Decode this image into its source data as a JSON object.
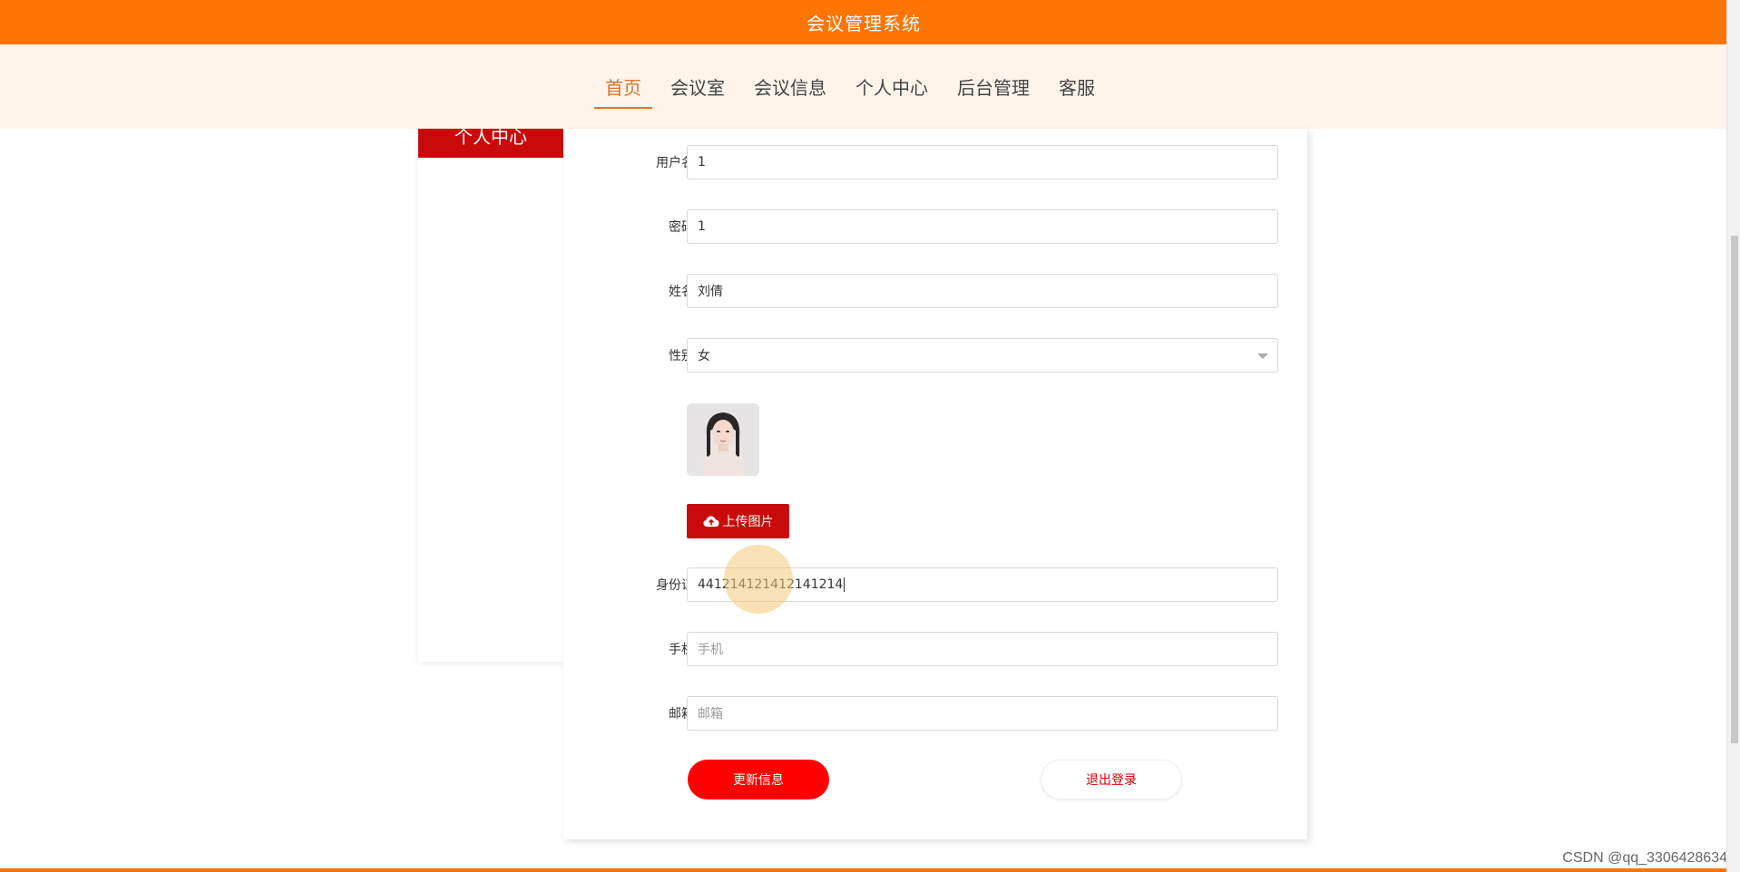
{
  "header": {
    "title": "会议管理系统"
  },
  "nav": {
    "items": [
      {
        "label": "首页",
        "active": true
      },
      {
        "label": "会议室",
        "active": false
      },
      {
        "label": "会议信息",
        "active": false
      },
      {
        "label": "个人中心",
        "active": false
      },
      {
        "label": "后台管理",
        "active": false
      },
      {
        "label": "客服",
        "active": false
      }
    ]
  },
  "sidebar": {
    "title": "个人中心"
  },
  "form": {
    "username": {
      "label": "用户名",
      "value": "1"
    },
    "password": {
      "label": "密码",
      "value": "1"
    },
    "name": {
      "label": "姓名",
      "value": "刘倩"
    },
    "gender": {
      "label": "性别",
      "value": "女"
    },
    "upload_label": "上传图片",
    "id_card": {
      "label": "身份证",
      "value": "441214121412141214"
    },
    "phone": {
      "label": "手机",
      "placeholder": "手机"
    },
    "email": {
      "label": "邮箱",
      "placeholder": "邮箱"
    },
    "update_label": "更新信息",
    "logout_label": "退出登录"
  },
  "watermark": "CSDN @qq_3306428634",
  "colors": {
    "header": "#ff7403",
    "nav_bg": "#fff4ea",
    "nav_active": "#d9742b",
    "primary_red": "#c90a0a",
    "button_red": "#ff0000"
  },
  "icons": {
    "upload": "cloud-upload-icon",
    "select_arrow": "chevron-down-icon"
  }
}
